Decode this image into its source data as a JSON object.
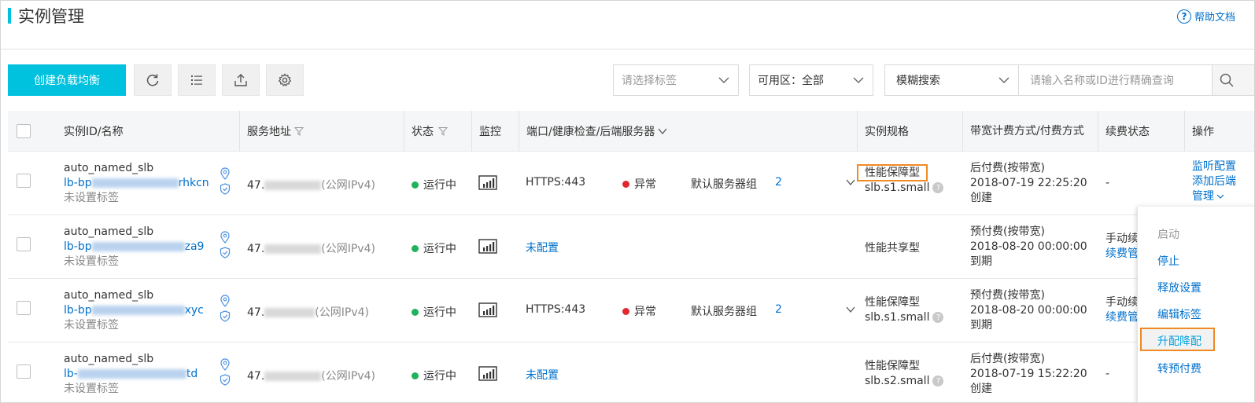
{
  "header": {
    "title": "实例管理",
    "help_label": "帮助文档"
  },
  "toolbar": {
    "create_label": "创建负载均衡",
    "tag_select_placeholder": "请选择标签",
    "zone_select_value": "可用区：全部",
    "search_mode_value": "模糊搜索",
    "search_placeholder": "请输入名称或ID进行精确查询"
  },
  "table": {
    "columns": {
      "id_name": "实例ID/名称",
      "address": "服务地址",
      "status": "状态",
      "monitor": "监控",
      "ports": "端口/健康检查/后端服务器",
      "spec": "实例规格",
      "billing": "带宽计费方式/付费方式",
      "renew": "续费状态",
      "actions": "操作"
    },
    "rows": [
      {
        "name": "auto_named_slb",
        "id_prefix": "lb-bp",
        "id_suffix": "rhkcn",
        "tag": "未设置标签",
        "addr_prefix": "47.",
        "addr_type": "(公网IPv4)",
        "status": "运行中",
        "listener": "HTTPS:443",
        "health": "异常",
        "group": "默认服务器组",
        "group_count": "2",
        "spec_type": "性能保障型",
        "spec_size": "slb.s1.small",
        "billing": "后付费(按带宽)",
        "billing_time": "2018-07-19 22:25:20",
        "billing_note": "创建",
        "renew": "-",
        "action1": "监听配置",
        "action2": "添加后端",
        "action3": "管理"
      },
      {
        "name": "auto_named_slb",
        "id_prefix": "lb-bp",
        "id_suffix": "za9",
        "tag": "未设置标签",
        "addr_prefix": "47.",
        "addr_type": "(公网IPv4)",
        "status": "运行中",
        "unconfigured": "未配置",
        "spec_type": "性能共享型",
        "billing": "预付费(按带宽)",
        "billing_time": "2018-08-20 00:00:00",
        "billing_note": "到期",
        "renew": "手动续",
        "renew_link": "续费管"
      },
      {
        "name": "auto_named_slb",
        "id_prefix": "lb-bp",
        "id_suffix": "xyc",
        "tag": "未设置标签",
        "addr_prefix": "47.",
        "addr_type": "(公网IPv4)",
        "status": "运行中",
        "listener": "HTTPS:443",
        "health": "异常",
        "group": "默认服务器组",
        "group_count": "2",
        "spec_type": "性能保障型",
        "spec_size": "slb.s1.small",
        "billing": "预付费(按带宽)",
        "billing_time": "2018-08-20 00:00:00",
        "billing_note": "到期",
        "renew": "手动续",
        "renew_link": "续费管"
      },
      {
        "name": "auto_named_slb",
        "id_prefix": "lb-",
        "id_suffix": "td",
        "tag": "未设置标签",
        "addr_prefix": "47.",
        "addr_type": "(公网IPv4)",
        "status": "运行中",
        "unconfigured": "未配置",
        "spec_type": "性能保障型",
        "spec_size": "slb.s2.small",
        "billing": "后付费(按带宽)",
        "billing_time": "2018-07-19 15:22:20",
        "billing_note": "创建",
        "renew": "-"
      }
    ]
  },
  "dropdown": {
    "items": [
      "启动",
      "停止",
      "释放设置",
      "编辑标签",
      "升配降配",
      "转预付费"
    ]
  },
  "colors": {
    "accent": "#00c1de",
    "link": "#0070cc",
    "running": "#1fb35b",
    "error": "#e0282e",
    "highlight": "#f08a24"
  }
}
